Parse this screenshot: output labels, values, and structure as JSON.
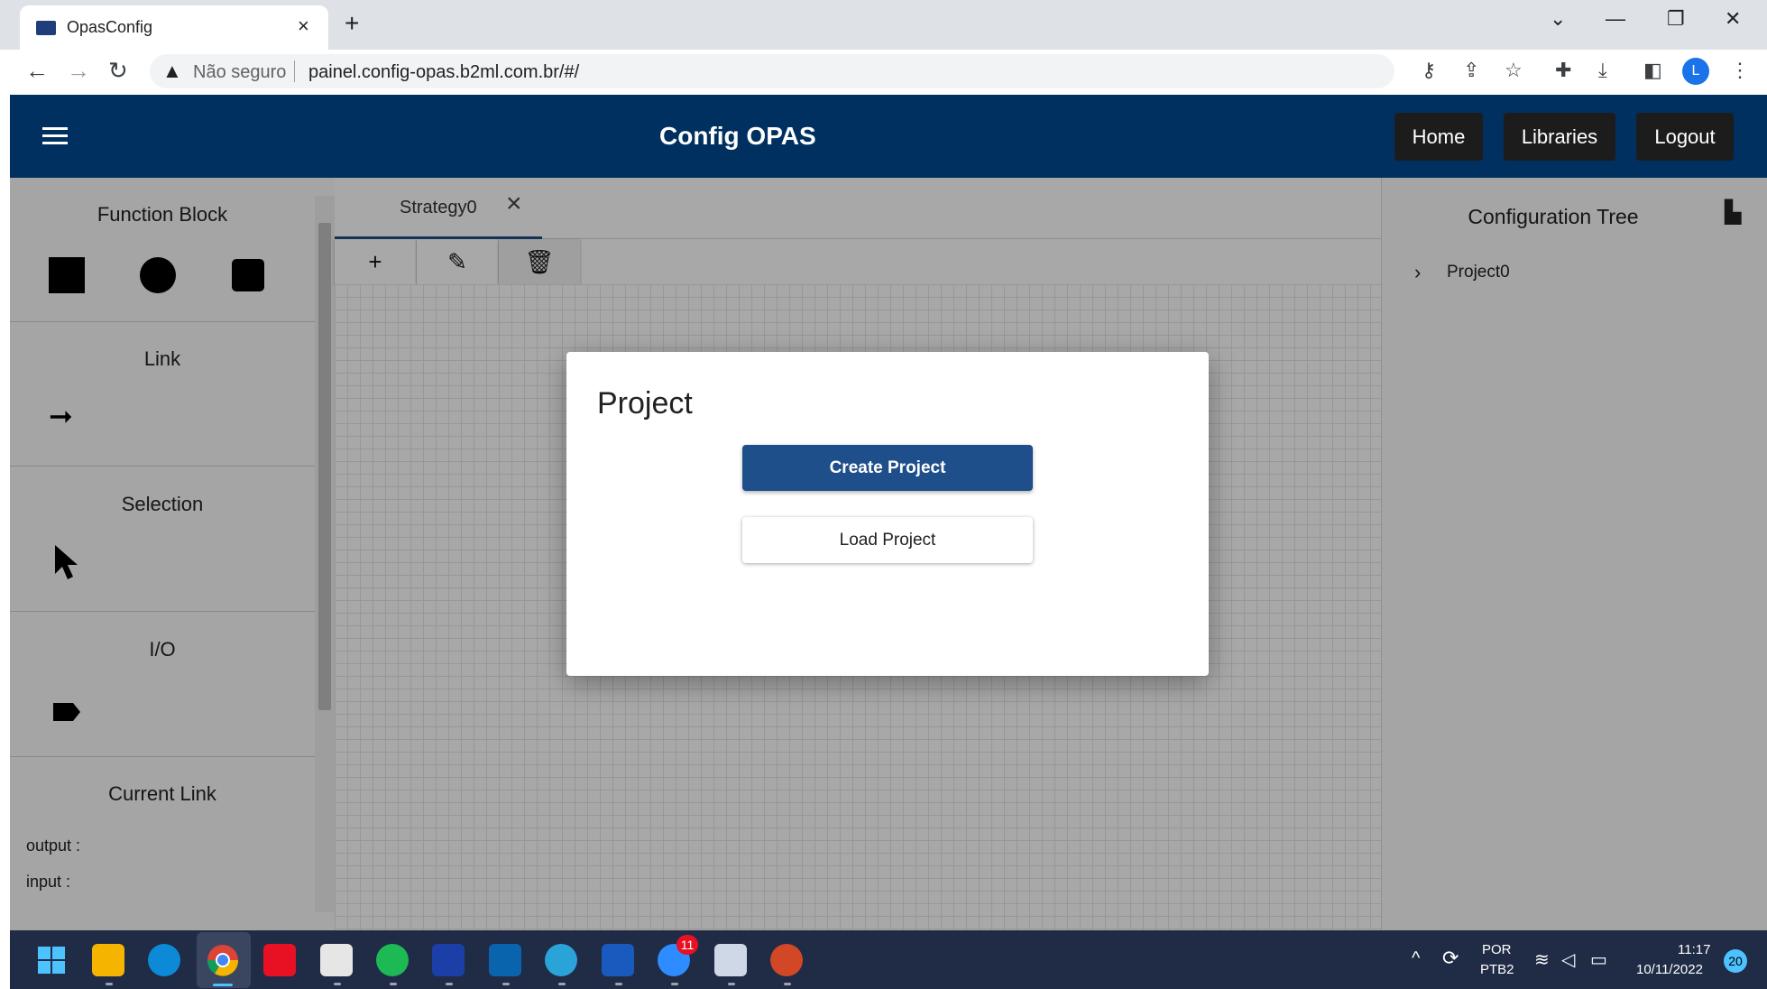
{
  "browser": {
    "tab_title": "OpasConfig",
    "tab_close": "×",
    "new_tab": "+",
    "security_label": "Não seguro",
    "url": "painel.config-opas.b2ml.com.br/#/",
    "profile_initial": "L"
  },
  "app": {
    "title": "Config OPAS",
    "nav": {
      "home": "Home",
      "libraries": "Libraries",
      "logout": "Logout"
    }
  },
  "left_panel": {
    "function_block": "Function Block",
    "link": "Link",
    "selection": "Selection",
    "io": "I/O",
    "current_link": "Current Link",
    "output_label": "output :",
    "input_label": "input :"
  },
  "center": {
    "strategy_tab": "Strategy0",
    "tab_close": "×"
  },
  "right_panel": {
    "title": "Configuration Tree",
    "tree_root": "Project0"
  },
  "dialog": {
    "title": "Project",
    "create_label": "Create Project",
    "load_label": "Load Project"
  },
  "taskbar": {
    "lang_top": "POR",
    "lang_bottom": "PTB2",
    "time": "11:17",
    "date": "10/11/2022",
    "notification_count": "20",
    "zoom_badge": "11"
  },
  "colors": {
    "header": "#00305f",
    "primary_button": "#1f4f8a",
    "nav_button": "#1c1c1c",
    "taskbar": "#202b45"
  }
}
